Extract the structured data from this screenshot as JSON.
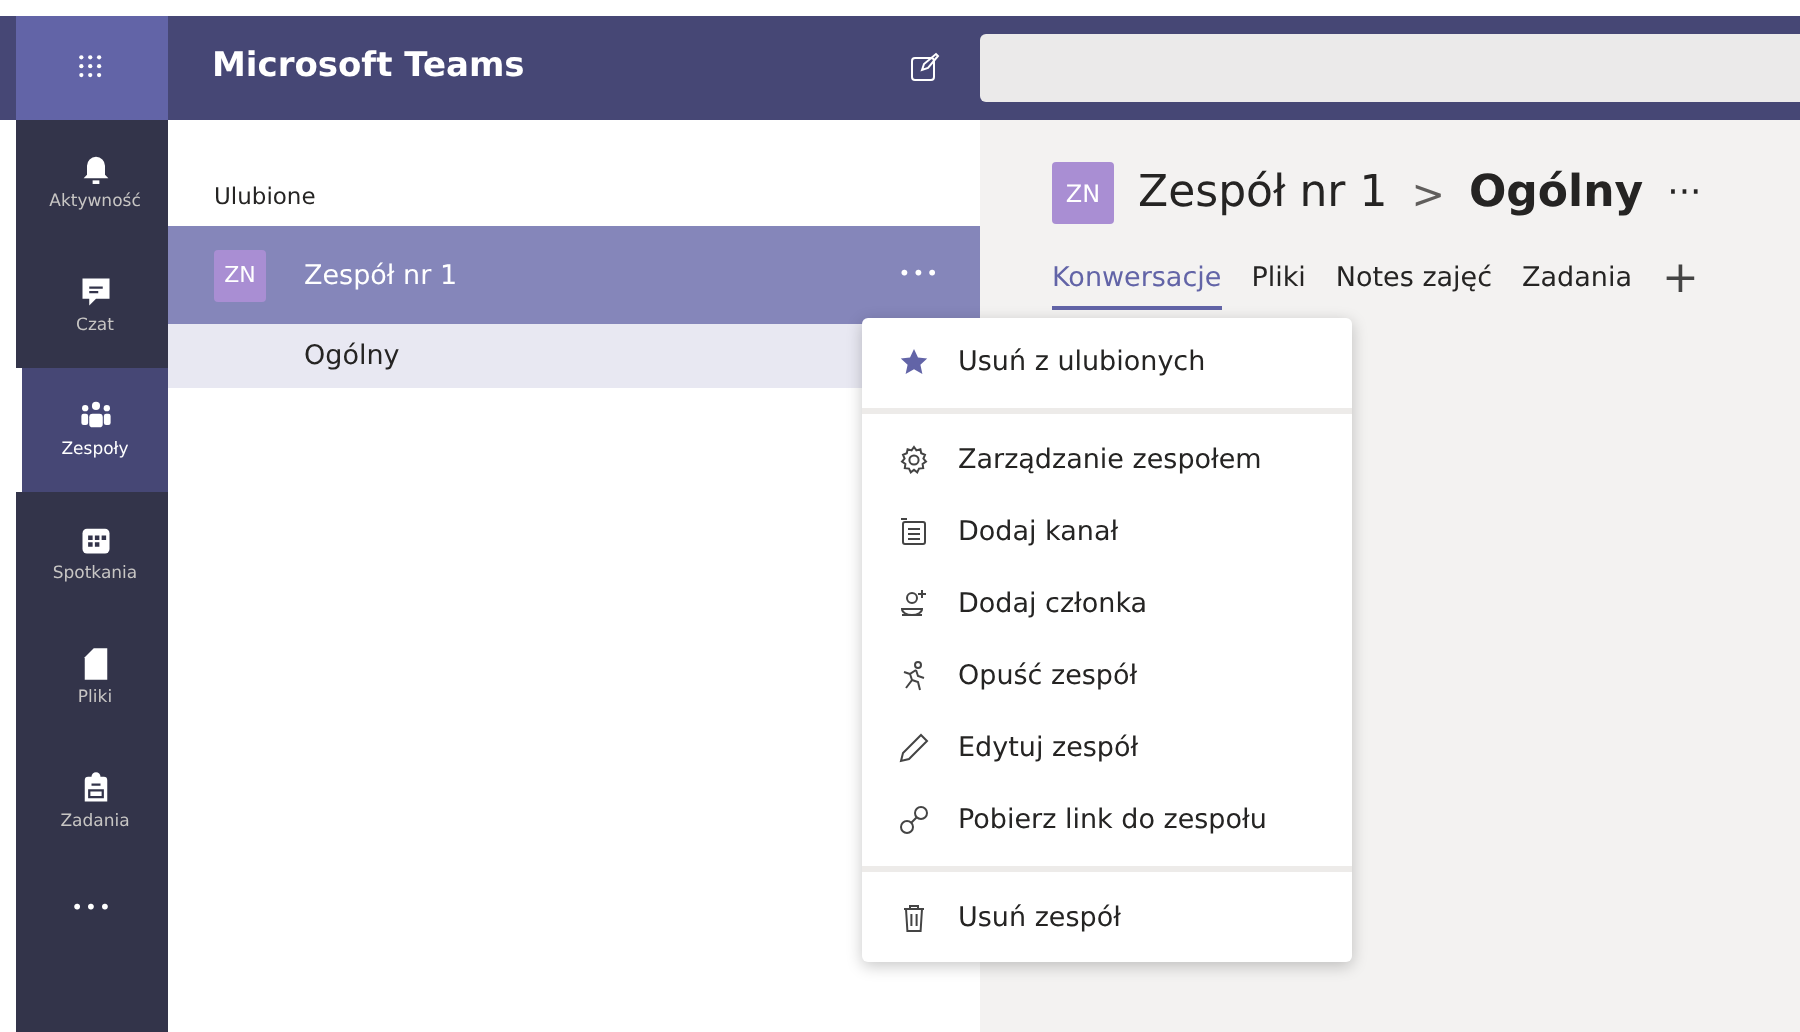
{
  "app": {
    "title": "Microsoft Teams"
  },
  "rail": [
    {
      "label": "Aktywność",
      "kind": "bell",
      "selected": false
    },
    {
      "label": "Czat",
      "kind": "chat",
      "selected": false
    },
    {
      "label": "Zespoły",
      "kind": "teams",
      "selected": true
    },
    {
      "label": "Spotkania",
      "kind": "calendar",
      "selected": false
    },
    {
      "label": "Pliki",
      "kind": "file",
      "selected": false
    },
    {
      "label": "Zadania",
      "kind": "bag",
      "selected": false
    }
  ],
  "rail_more": "•••",
  "sidebar": {
    "section": "Ulubione",
    "teams": [
      {
        "avatar": "ZN",
        "name": "Zespół nr 1",
        "more": "•••",
        "selected": true,
        "channels": [
          {
            "name": "Ogólny",
            "selected": true
          }
        ]
      }
    ]
  },
  "channel_header": {
    "avatar": "ZN",
    "team": "Zespół nr 1",
    "separator": ">",
    "channel": "Ogólny",
    "more": "···"
  },
  "tabs": [
    {
      "label": "Konwersacje",
      "selected": true
    },
    {
      "label": "Pliki",
      "selected": false
    },
    {
      "label": "Notes zajęć",
      "selected": false
    },
    {
      "label": "Zadania",
      "selected": false
    }
  ],
  "add_tab": "+",
  "menu": {
    "groups": [
      [
        {
          "label": "Usuń z ulubionych",
          "kind": "star"
        }
      ],
      [
        {
          "label": "Zarządzanie zespołem",
          "kind": "gear"
        },
        {
          "label": "Dodaj kanał",
          "kind": "channel"
        },
        {
          "label": "Dodaj członka",
          "kind": "person-add"
        },
        {
          "label": "Opuść zespół",
          "kind": "leave"
        },
        {
          "label": "Edytuj zespół",
          "kind": "pencil"
        },
        {
          "label": "Pobierz link do zespołu",
          "kind": "link"
        }
      ],
      [
        {
          "label": "Usuń zespół",
          "kind": "trash"
        }
      ]
    ]
  }
}
